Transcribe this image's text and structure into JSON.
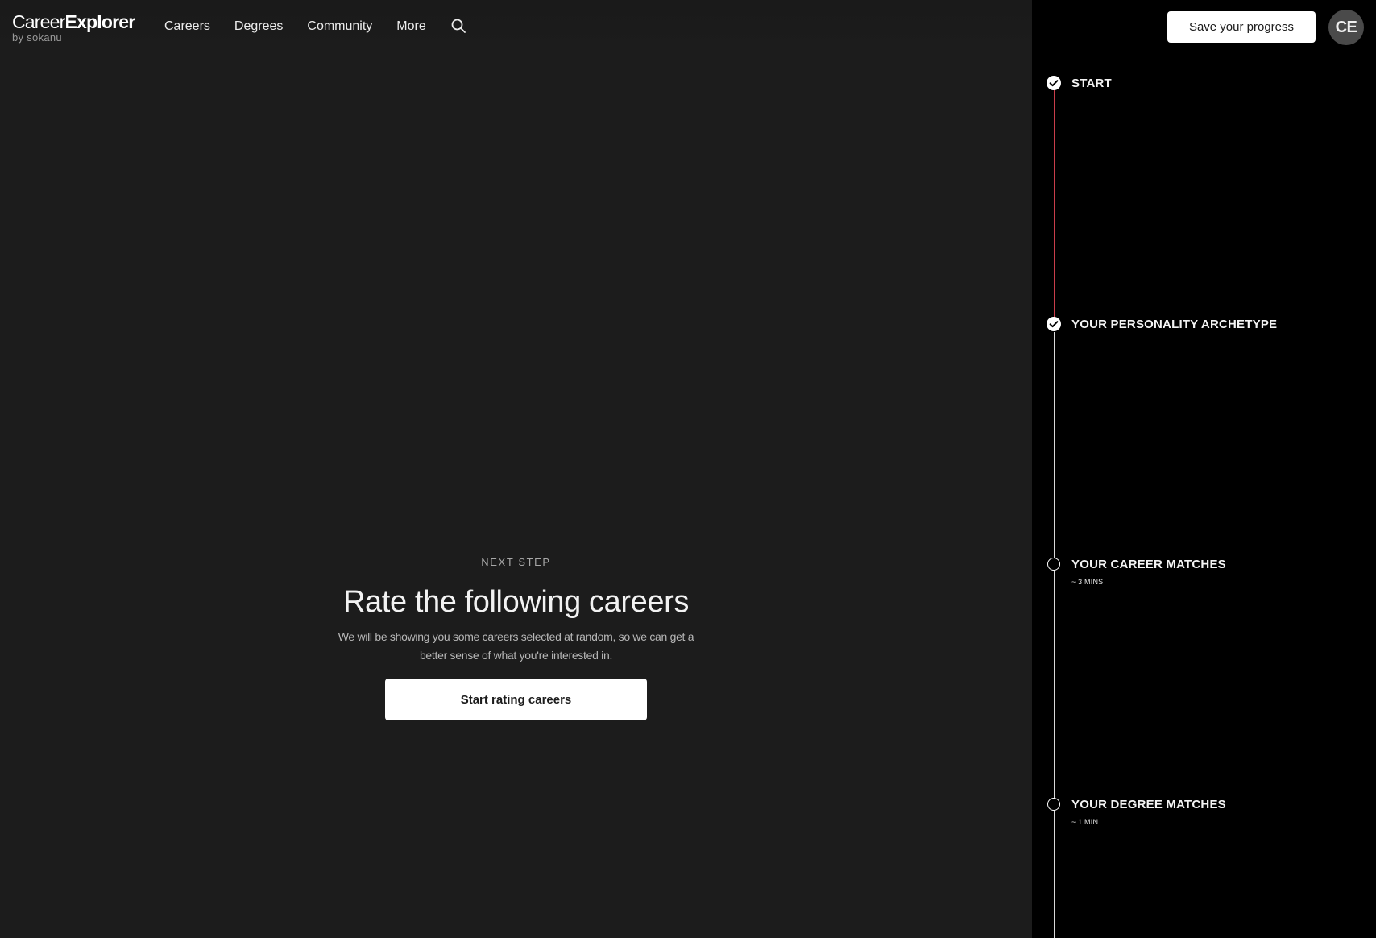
{
  "header": {
    "logo": {
      "light_text": "Career",
      "bold_text": "Explorer",
      "sub_text": "by sokanu"
    },
    "nav": [
      {
        "label": "Careers"
      },
      {
        "label": "Degrees"
      },
      {
        "label": "Community"
      },
      {
        "label": "More"
      }
    ],
    "search_icon": "search-icon"
  },
  "main": {
    "eyebrow": "NEXT STEP",
    "title": "Rate the following careers",
    "description": "We will be showing you some careers selected at random, so we can get a better sense of what you're interested in.",
    "cta_label": "Start rating careers"
  },
  "sidebar": {
    "save_label": "Save your progress",
    "avatar_initials": "CE",
    "steps": [
      {
        "label": "START",
        "duration": "",
        "status": "done",
        "icon": "check-circle-icon"
      },
      {
        "label": "YOUR PERSONALITY ARCHETYPE",
        "duration": "",
        "status": "done",
        "icon": "check-circle-icon"
      },
      {
        "label": "YOUR CAREER MATCHES",
        "duration": "~ 3 MINS",
        "status": "todo",
        "icon": "empty-circle-icon"
      },
      {
        "label": "YOUR DEGREE MATCHES",
        "duration": "~ 1 MIN",
        "status": "todo",
        "icon": "empty-circle-icon"
      }
    ]
  },
  "colors": {
    "main_bg": "#1c1c1c",
    "sidebar_bg": "#000000",
    "progress_done": "#c93d4a",
    "progress_todo": "#d9d9d9",
    "button_bg": "#ffffff"
  }
}
